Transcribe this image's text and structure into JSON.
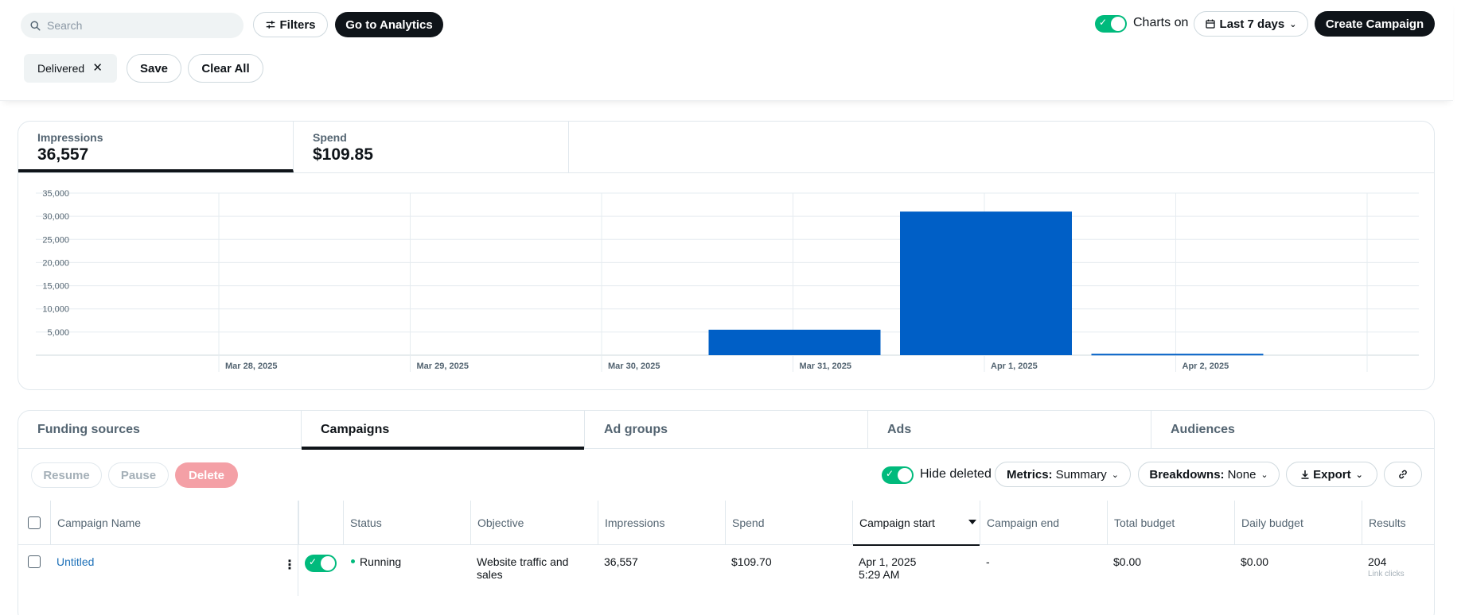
{
  "header": {
    "search_placeholder": "Search",
    "filters_label": "Filters",
    "analytics_label": "Go to Analytics",
    "charts_label": "Charts on",
    "charts_on": true,
    "date_range_label": "Last 7 days",
    "create_label": "Create Campaign"
  },
  "filter_bar": {
    "chips": [
      "Delivered"
    ],
    "save_label": "Save",
    "clear_label": "Clear All"
  },
  "metrics": [
    {
      "label": "Impressions",
      "value": "36,557",
      "selected": true
    },
    {
      "label": "Spend",
      "value": "$109.85",
      "selected": false
    }
  ],
  "chart_data": {
    "type": "bar",
    "categories": [
      "Mar 28, 2025",
      "Mar 29, 2025",
      "Mar 30, 2025",
      "Mar 31, 2025",
      "Apr 1, 2025",
      "Apr 2, 2025"
    ],
    "values": [
      0,
      0,
      0,
      5500,
      31000,
      300
    ],
    "yticks": [
      "5,000",
      "10,000",
      "15,000",
      "20,000",
      "25,000",
      "30,000",
      "35,000"
    ],
    "ylim": [
      0,
      35000
    ],
    "bar_color": "#005fc6",
    "grid": true
  },
  "table": {
    "tabs": [
      {
        "label": "Funding sources",
        "active": false
      },
      {
        "label": "Campaigns",
        "active": true
      },
      {
        "label": "Ad groups",
        "active": false
      },
      {
        "label": "Ads",
        "active": false
      },
      {
        "label": "Audiences",
        "active": false
      }
    ],
    "actions": {
      "resume": "Resume",
      "pause": "Pause",
      "delete": "Delete"
    },
    "hide_deleted_label": "Hide deleted",
    "metrics_key": "Metrics:",
    "metrics_value": "Summary",
    "breakdowns_key": "Breakdowns:",
    "breakdowns_value": "None",
    "export_label": "Export",
    "columns": [
      "Campaign Name",
      "Status",
      "Objective",
      "Impressions",
      "Spend",
      "Campaign start",
      "Campaign end",
      "Total budget",
      "Daily budget",
      "Results"
    ],
    "rows": [
      {
        "name": "Untitled",
        "status": "Running",
        "objective_line1": "Website traffic and",
        "objective_line2": "sales",
        "impressions": "36,557",
        "spend": "$109.70",
        "start_date": "Apr 1, 2025",
        "start_time": "5:29 AM",
        "end": "-",
        "total_budget": "$0.00",
        "daily_budget": "$0.00",
        "results": "204",
        "results_sub": "Link clicks"
      }
    ]
  }
}
